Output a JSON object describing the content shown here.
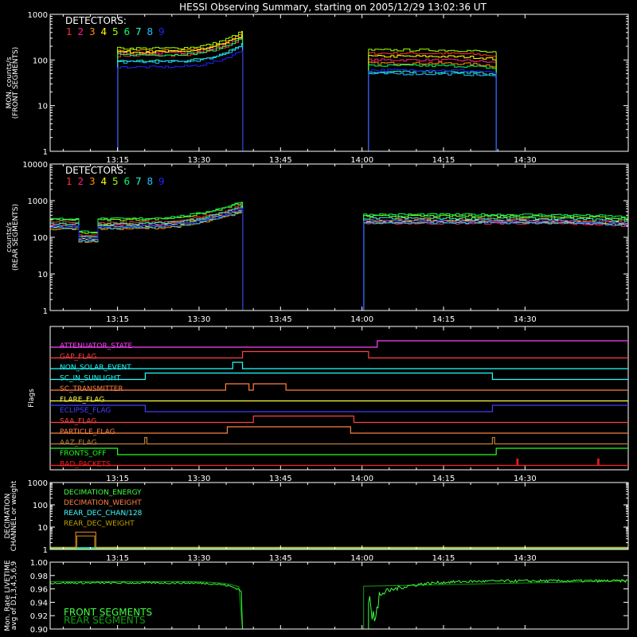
{
  "title": "HESSI Observing Summary, starting on 2005/12/29 13:02:36 UT",
  "time_axis": {
    "ticks": [
      "13:15",
      "13:30",
      "13:45",
      "14:00",
      "14:15",
      "14:30"
    ],
    "tick_minutes": [
      795,
      810,
      825,
      840,
      855,
      870
    ],
    "range_minutes": [
      782.6,
      889.0
    ]
  },
  "colors": {
    "det": [
      "#ff3030",
      "#ff2080",
      "#ff9000",
      "#ffff00",
      "#a0ff00",
      "#00ff60",
      "#20ffd0",
      "#20c0ff",
      "#2020ff"
    ]
  },
  "chart_data": [
    {
      "type": "line",
      "id": "front",
      "ylabel": "MON. counts/s",
      "ylabel2": "(FRONT SEGMENTS)",
      "yscale": "log",
      "ylim": [
        1,
        1000
      ],
      "yticks": [
        "1",
        "10",
        "100",
        "1000"
      ],
      "legend_title": "DETECTORS:",
      "legend_digits": [
        "1",
        "2",
        "3",
        "4",
        "5",
        "6",
        "7",
        "8",
        "9"
      ],
      "segments": [
        {
          "start": 795.0,
          "end": 818.0,
          "levels": [
            125,
            140,
            160,
            150,
            180,
            130,
            95,
            90,
            70
          ],
          "end_scale": 2.4
        },
        {
          "start": 841.2,
          "end": 864.7,
          "levels": [
            140,
            100,
            85,
            120,
            165,
            75,
            55,
            50,
            60
          ],
          "end_scale": 0.85
        }
      ],
      "baseline": 1
    },
    {
      "type": "line",
      "id": "rear",
      "ylabel": "counts/s",
      "ylabel2": "(REAR SEGMENTS)",
      "yscale": "log",
      "ylim": [
        1,
        10000
      ],
      "yticks": [
        "1",
        "10",
        "100",
        "1000",
        "10000"
      ],
      "legend_title": "DETECTORS:",
      "legend_digits": [
        "1",
        "2",
        "3",
        "4",
        "5",
        "6",
        "7",
        "8",
        "9"
      ],
      "segments": [
        {
          "start": 782.6,
          "end": 818.0,
          "levels": [
            250,
            220,
            170,
            200,
            300,
            320,
            230,
            180,
            200
          ],
          "end_scale": 3.0,
          "dip": [
            787.5,
            791.2,
            0.45
          ]
        },
        {
          "start": 840.3,
          "end": 889.0,
          "levels": [
            300,
            240,
            260,
            280,
            380,
            420,
            330,
            250,
            280
          ],
          "end_scale": 0.85
        }
      ],
      "baseline": 1
    },
    {
      "type": "line",
      "id": "flags",
      "ylabel": "Flags",
      "flags": [
        {
          "name": "ATTENUATOR_STATE",
          "color": "#ff40ff",
          "edges": [
            842.8
          ],
          "start_high": false
        },
        {
          "name": "GAP_FLAG",
          "color": "#ff4040",
          "edges": [
            818.0,
            841.2
          ],
          "start_high": false
        },
        {
          "name": "NON_SOLAR_EVENT",
          "color": "#20ffff",
          "edges": [
            816.2,
            818.0
          ],
          "start_high": false
        },
        {
          "name": "SC_IN_SUNLIGHT",
          "color": "#20ffff",
          "edges": [
            800.1,
            864.0
          ],
          "start_high": false
        },
        {
          "name": "SC_TRANSMITTER",
          "color": "#ff8040",
          "edges": [
            814.9,
            819.2,
            820.0,
            826.0
          ],
          "start_high": false
        },
        {
          "name": "FLARE_FLAG",
          "color": "#ffff40",
          "edges": [],
          "start_high": false
        },
        {
          "name": "ECLIPSE_FLAG",
          "color": "#4040ff",
          "edges": [
            800.1,
            864.0
          ],
          "start_high": true
        },
        {
          "name": "SAA_FLAG",
          "color": "#ff4040",
          "edges": [
            820.0,
            838.5
          ],
          "start_high": false
        },
        {
          "name": "PARTICLE_FLAG",
          "color": "#ff8040",
          "edges": [
            815.2,
            837.9
          ],
          "start_high": false
        },
        {
          "name": "AAZ_FLAG",
          "color": "#c08040",
          "edges": [
            800.0,
            800.4,
            864.0,
            864.4
          ],
          "start_high": false
        },
        {
          "name": "FRONTS_OFF",
          "color": "#20ff20",
          "edges": [
            795.0,
            864.7
          ],
          "start_high": true
        },
        {
          "name": "BAD_PACKETS",
          "color": "#ff2020",
          "edges": [
            868.5,
            868.7,
            883.4,
            883.6
          ],
          "start_high": false
        }
      ]
    },
    {
      "type": "line",
      "id": "decimation",
      "ylabel": "DECIMATION",
      "ylabel2": "CHANNEL or weight",
      "yscale": "log",
      "ylim": [
        1,
        1000
      ],
      "yticks": [
        "1",
        "10",
        "100",
        "1000"
      ],
      "series": [
        {
          "name": "DECIMATION_ENERGY",
          "color": "#40ff40",
          "edges": [],
          "base": 1,
          "high": 1
        },
        {
          "name": "DECIMATION_WEIGHT",
          "color": "#ff8040",
          "edges": [
            787.3,
            791.0
          ],
          "base": 1,
          "high": 6
        },
        {
          "name": "REAR_DEC_CHAN/128",
          "color": "#40ffff",
          "edges": [],
          "base": 1,
          "high": 1
        },
        {
          "name": "REAR_DEC_WEIGHT",
          "color": "#c0a000",
          "edges": [
            787.5,
            790.8
          ],
          "base": 1,
          "high": 4
        }
      ]
    },
    {
      "type": "line",
      "id": "livetime",
      "ylabel": "Mon. Rate LIVETIME",
      "ylabel2": "avg of D1,3,4,5,6,9",
      "ylim": [
        0.9,
        1.0
      ],
      "yticks": [
        "0.90",
        "0.92",
        "0.94",
        "0.96",
        "0.98",
        "1.00"
      ],
      "series": [
        {
          "name": "FRONT SEGMENTS",
          "color": "#40ff40"
        },
        {
          "name": "REAR SEGMENTS",
          "color": "#10a010"
        }
      ]
    }
  ]
}
